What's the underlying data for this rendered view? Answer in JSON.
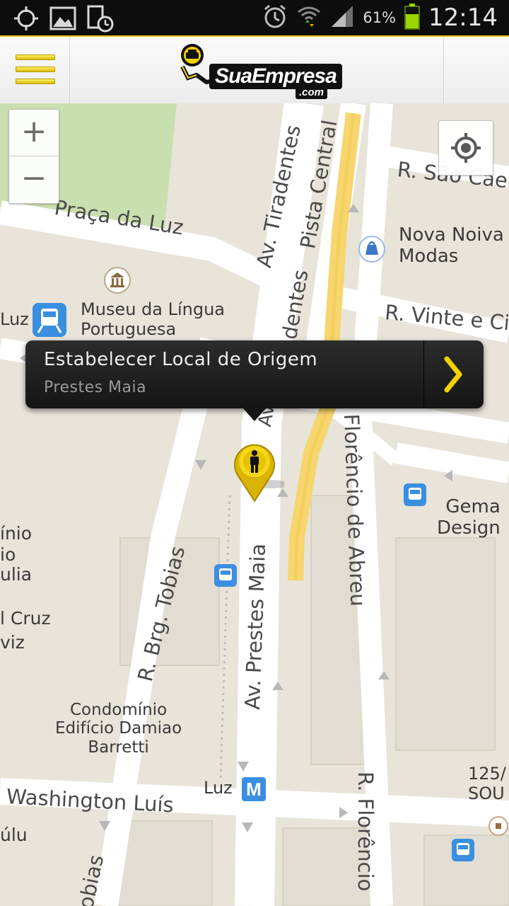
{
  "status_bar": {
    "battery_percent": "61%",
    "time": "12:14",
    "icons": [
      "gps-icon",
      "gallery-icon",
      "screenshot-icon",
      "alarm-icon",
      "wifi-icon",
      "signal-icon",
      "battery-icon"
    ]
  },
  "app_bar": {
    "logo_text": "SuaEmpresa",
    "logo_subtext": ".com",
    "accent_color": "#f2d100"
  },
  "map": {
    "zoom_in_label": "+",
    "zoom_out_label": "−",
    "streets": [
      "Praça da Luz",
      "Av. Tiradentes",
      "Pista Central",
      "R. São Cae",
      "R. Vinte e Ci",
      "dentes",
      "Florêncio de Abreu",
      "Av. Prestes Maia",
      "R. Brg. Tobias",
      "Washington Luís",
      "R. Florêncio",
      "obias",
      "Av."
    ],
    "places": {
      "museu": "Museu da Língua",
      "museu_line2": "Portuguesa",
      "luz_station": "Luz",
      "nova_noiva_1": "Nova Noiva",
      "nova_noiva_2": "Modas",
      "gema_1": "Gema",
      "gema_2": "Design",
      "condominio_1": "Condomínio",
      "condominio_2": "Edifício Damiao",
      "condominio_3": "Barretti",
      "luz_metro": "Luz",
      "metro_letter": "M",
      "num_125": "125/",
      "sou": "SOU",
      "left_1": "ínio",
      "left_2": "io",
      "left_3": "ulia",
      "left_4": "l Cruz",
      "left_5": "viz",
      "left_6": "úlu"
    }
  },
  "callout": {
    "title": "Estabelecer Local de Origem",
    "subtitle": "Prestes Maia"
  }
}
